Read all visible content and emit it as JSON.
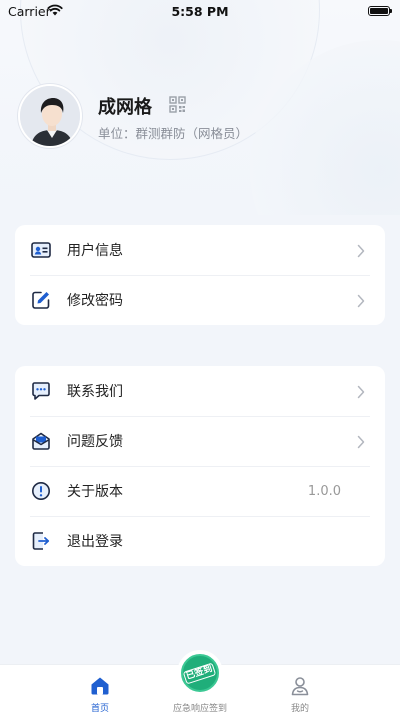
{
  "status_bar": {
    "carrier": "Carrier",
    "time": "5:58 PM"
  },
  "profile": {
    "name": "成网格",
    "unit": "单位：群测群防（网格员）"
  },
  "menu_group_1": [
    {
      "label": "用户信息",
      "icon": "id-card-icon"
    },
    {
      "label": "修改密码",
      "icon": "edit-icon"
    }
  ],
  "menu_group_2": [
    {
      "label": "联系我们",
      "icon": "chat-icon"
    },
    {
      "label": "问题反馈",
      "icon": "mail-icon"
    },
    {
      "label": "关于版本",
      "icon": "info-icon",
      "value": "1.0.0"
    },
    {
      "label": "退出登录",
      "icon": "logout-icon"
    }
  ],
  "tab_bar": {
    "home_label": "首页",
    "checkin_label": "应急响应签到",
    "checkin_badge": "已签到",
    "mine_label": "我的"
  },
  "colors": {
    "accent": "#1f5fd0",
    "checkin_green": "#1fae7a",
    "background": "#f2f5fa"
  }
}
